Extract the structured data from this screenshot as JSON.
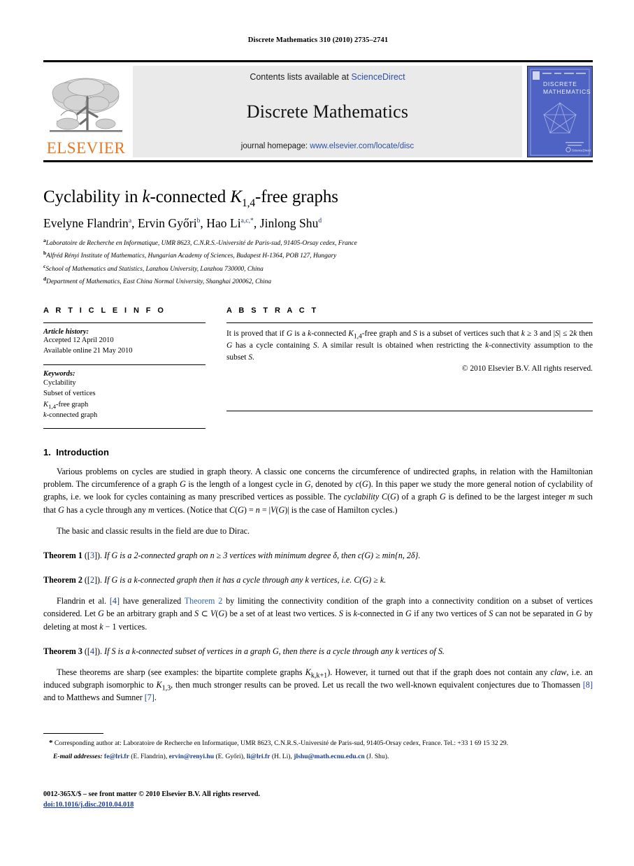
{
  "running_head": "Discrete Mathematics 310 (2010) 2735–2741",
  "masthead": {
    "contents_prefix": "Contents lists available at ",
    "contents_link": "ScienceDirect",
    "journal_title": "Discrete Mathematics",
    "homepage_prefix": "journal homepage: ",
    "homepage_link": "www.elsevier.com/locate/disc",
    "publisher_wordmark": "ELSEVIER",
    "cover": {
      "line1": "DISCRETE",
      "line2": "MATHEMATICS",
      "badge": "ScienceDirect",
      "color": "#4f63c4"
    }
  },
  "article": {
    "title_pre": "Cyclability in ",
    "title_k": "k",
    "title_mid": "-connected ",
    "title_K": "K",
    "title_sub": "1,4",
    "title_post": "-free graphs",
    "authors": [
      {
        "name": "Evelyne Flandrin",
        "sup": "a"
      },
      {
        "name": "Ervin Győri",
        "sup": "b"
      },
      {
        "name": "Hao Li",
        "sup": "a,c,*"
      },
      {
        "name": "Jinlong Shu",
        "sup": "d"
      }
    ],
    "affiliations": [
      {
        "mark": "a",
        "text": "Laboratoire de Recherche en Informatique, UMR 8623, C.N.R.S.-Université de Paris-sud, 91405-Orsay cedex, France"
      },
      {
        "mark": "b",
        "text": "Alfréd Rényi Institute of Mathematics, Hungarian Academy of Sciences, Budapest H-1364, POB 127, Hungary"
      },
      {
        "mark": "c",
        "text": "School of Mathematics and Statistics, Lanzhou University, Lanzhou 730000, China"
      },
      {
        "mark": "d",
        "text": "Department of Mathematics, East China Normal University, Shanghai 200062, China"
      }
    ]
  },
  "info": {
    "heading": "A R T I C L E  I N F O",
    "history_label": "Article history:",
    "history_lines": [
      "Accepted 12 April 2010",
      "Available online 21 May 2010"
    ],
    "keywords_label": "Keywords:",
    "keywords": [
      "Cyclability",
      "Subset of vertices",
      "K₁,₄-free graph",
      "k-connected graph"
    ]
  },
  "abstract": {
    "heading": "A B S T R A C T",
    "text": "It is proved that if G is a k-connected K1,4-free graph and S is a subset of vertices such that k ≥ 3 and |S| ≤ 2k then G has a cycle containing S. A similar result is obtained when restricting the k-connectivity assumption to the subset S.",
    "rights": "© 2010 Elsevier B.V. All rights reserved."
  },
  "body": {
    "section_number": "1.",
    "section_title": "Introduction",
    "paragraph1": "Various problems on cycles are studied in graph theory. A classic one concerns the circumference of undirected graphs, in relation with the Hamiltonian problem. The circumference of a graph G is the length of a longest cycle in G, denoted by c(G). In this paper we study the more general notion of cyclability of graphs, i.e. we look for cycles containing as many prescribed vertices as possible. The cyclability C(G) of a graph G is defined to be the largest integer m such that G has a cycle through any m vertices. (Notice that C(G) = n = |V(G)| is the case of Hamilton cycles.)",
    "paragraph2": "The basic and classic results in the field are due to Dirac.",
    "theorem1": {
      "label": "Theorem 1",
      "cite": "3",
      "statement": "If G is a 2-connected graph on n ≥ 3 vertices with minimum degree δ, then c(G) ≥ min{n, 2δ}."
    },
    "theorem2": {
      "label": "Theorem 2",
      "cite": "2",
      "statement": "If G is a k-connected graph then it has a cycle through any k vertices, i.e. C(G) ≥ k."
    },
    "paragraph3": {
      "part1": "Flandrin et al. ",
      "cite": "[4]",
      "part2": " have generalized ",
      "xref": "Theorem 2",
      "part3": " by limiting the connectivity condition of the graph into a connectivity condition on a subset of vertices considered. Let G be an arbitrary graph and S ⊂ V(G) be a set of at least two vertices. S is k-connected in G if any two vertices of S can not be separated in G by deleting at most k − 1 vertices."
    },
    "theorem3": {
      "label": "Theorem 3",
      "cite": "4",
      "statement": "If S is a k-connected subset of vertices in a graph G, then there is a cycle through any k vertices of S."
    },
    "paragraph4": {
      "part1": "These theorems are sharp (see examples: the bipartite complete graphs K",
      "sub1": "k,k+1",
      "part2": "). However, it turned out that if the graph does not contain any ",
      "claw": "claw",
      "part3": ", i.e. an induced subgraph isomorphic to K",
      "sub2": "1,3",
      "part4": ", then much stronger results can be proved. Let us recall the two well-known equivalent conjectures due to Thomassen ",
      "cite1": "[8]",
      "part5": " and to Matthews and Sumner ",
      "cite2": "[7]",
      "part6": "."
    }
  },
  "footnotes": {
    "corresponding": "Corresponding author at: Laboratoire de Recherche en Informatique, UMR 8623, C.N.R.S.-Université de Paris-sud, 91405-Orsay cedex, France. Tel.: +33 1 69 15 32 29.",
    "email_label": "E-mail addresses:",
    "emails": [
      {
        "address": "fe@lri.fr",
        "person": "(E. Flandrin)"
      },
      {
        "address": "ervin@renyi.hu",
        "person": "(E. Győri)"
      },
      {
        "address": "li@lri.fr",
        "person": "(H. Li)"
      },
      {
        "address": "jlshu@math.ecnu.edu.cn",
        "person": "(J. Shu)"
      }
    ]
  },
  "copyright": {
    "line": "0012-365X/$ – see front matter © 2010 Elsevier B.V. All rights reserved.",
    "doi": "doi:10.1016/j.disc.2010.04.018"
  }
}
